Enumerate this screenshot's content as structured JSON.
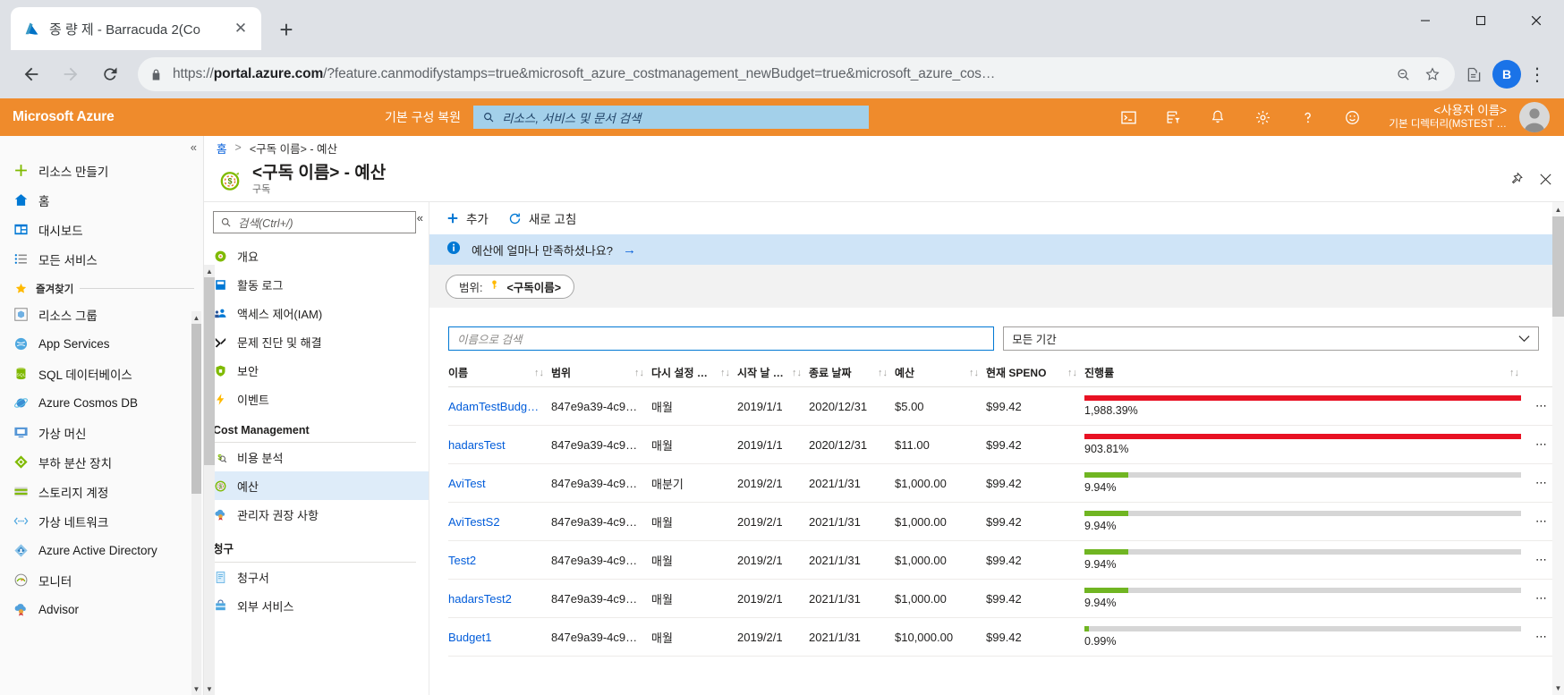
{
  "browser": {
    "tab_title": "종 량 제 - Barracuda 2(Co",
    "tab_close": "✕",
    "newtab": "+",
    "url_prefix": "https://",
    "url_domain": "portal.azure.com",
    "url_rest": "/?feature.canmodifystamps=true&microsoft_azure_costmanagement_newBudget=true&microsoft_azure_cos…",
    "profile_initial": "B",
    "ext_dots": "⋮"
  },
  "azure_header": {
    "brand": "Microsoft Azure",
    "restore_default": "기본 구성 복원",
    "search_placeholder": "리소스, 서비스 및 문서 검색",
    "user_name": "<사용자 이름>",
    "user_directory": "기본 디렉터리(MSTEST …",
    "icons": [
      "cloud-shell-icon",
      "directories-filter-icon",
      "notifications-icon",
      "settings-gear-icon",
      "help-icon",
      "feedback-smiley-icon"
    ]
  },
  "leftnav": {
    "collapse": "«",
    "items": [
      {
        "label": "리소스 만들기",
        "icon": "plus-icon"
      },
      {
        "label": "홈",
        "icon": "home-icon"
      },
      {
        "label": "대시보드",
        "icon": "dashboard-icon"
      },
      {
        "label": "모든 서비스",
        "icon": "all-services-icon"
      }
    ],
    "favorites_label": "즐겨찾기",
    "favorites": [
      {
        "label": "리소스 그룹",
        "icon": "resource-group-icon"
      },
      {
        "label": "App Services",
        "icon": "app-services-icon"
      },
      {
        "label": "SQL 데이터베이스",
        "icon": "sql-database-icon"
      },
      {
        "label": "Azure Cosmos DB",
        "icon": "cosmos-db-icon"
      },
      {
        "label": "가상 머신",
        "icon": "virtual-machine-icon"
      },
      {
        "label": "부하 분산 장치",
        "icon": "load-balancer-icon"
      },
      {
        "label": "스토리지 계정",
        "icon": "storage-account-icon"
      },
      {
        "label": "가상 네트워크",
        "icon": "virtual-network-icon"
      },
      {
        "label": "Azure Active Directory",
        "icon": "azure-ad-icon"
      },
      {
        "label": "모니터",
        "icon": "monitor-icon"
      },
      {
        "label": "Advisor",
        "icon": "advisor-icon"
      }
    ]
  },
  "blade": {
    "breadcrumb_home": "홈",
    "breadcrumb_sep": ">",
    "breadcrumb_current": "<구독 이름> - 예산",
    "title": "<구독 이름> - 예산",
    "subtitle": "구독",
    "pin_icon": "pin-icon",
    "close_icon": "close-icon",
    "menu_search_placeholder": "검색(Ctrl+/)",
    "menu_collapse": "«",
    "menu_items": [
      {
        "label": "개요",
        "icon": "overview-icon"
      },
      {
        "label": "활동 로그",
        "icon": "activity-log-icon"
      },
      {
        "label": "액세스 제어(IAM)",
        "icon": "access-control-icon"
      },
      {
        "label": "문제 진단 및 해결",
        "icon": "troubleshoot-icon"
      },
      {
        "label": "보안",
        "icon": "security-shield-icon"
      },
      {
        "label": "이벤트",
        "icon": "events-bolt-icon"
      }
    ],
    "group_cost_management": "Cost Management",
    "cost_items": [
      {
        "label": "비용 분석",
        "icon": "cost-analysis-icon",
        "active": false
      },
      {
        "label": "예산",
        "icon": "budget-icon",
        "active": true
      },
      {
        "label": "관리자 권장 사항",
        "icon": "advisor-recommendations-icon",
        "active": false
      }
    ],
    "group_billing": "청구",
    "billing_items": [
      {
        "label": "청구서",
        "icon": "invoice-icon"
      },
      {
        "label": "외부 서비스",
        "icon": "external-services-icon"
      }
    ]
  },
  "content": {
    "commands": [
      {
        "label": "추가",
        "icon": "plus-icon"
      },
      {
        "label": "새로 고침",
        "icon": "refresh-icon"
      }
    ],
    "info_message": "예산에 얼마나 만족하셨나요?",
    "info_arrow": "→",
    "info_icon": "info-icon",
    "scope_label": "범위:",
    "scope_icon": "key-icon",
    "scope_value": "<구독이름>",
    "search_placeholder": "이름으로 검색",
    "period_value": "모든 기간",
    "period_chevron": "⌄",
    "table": {
      "columns": [
        {
          "label": "이름",
          "sortable": true
        },
        {
          "label": "범위",
          "sortable": true
        },
        {
          "label": "다시 설정 …",
          "sortable": true
        },
        {
          "label": "시작 날 …",
          "sortable": true
        },
        {
          "label": "종료 날짜",
          "sortable": true
        },
        {
          "label": "예산",
          "sortable": true
        },
        {
          "label": "현재 SPENO",
          "sortable": true
        },
        {
          "label": "진행률",
          "sortable": true
        }
      ],
      "sort_glyph": "↑↓",
      "row_menu_glyph": "⋯",
      "rows": [
        {
          "name": "AdamTestBudg…",
          "scope": "847e9a39-4c9…",
          "reset": "매월",
          "start": "2019/1/1",
          "end": "2020/12/31",
          "budget": "$5.00",
          "spend": "$99.42",
          "progress_label": "1,988.39%",
          "progress_pct": 100,
          "progress_color": "#e81123"
        },
        {
          "name": "hadarsTest",
          "scope": "847e9a39-4c9…",
          "reset": "매월",
          "start": "2019/1/1",
          "end": "2020/12/31",
          "budget": "$11.00",
          "spend": "$99.42",
          "progress_label": "903.81%",
          "progress_pct": 100,
          "progress_color": "#e81123"
        },
        {
          "name": "AviTest",
          "scope": "847e9a39-4c9…",
          "reset": "매분기",
          "start": "2019/2/1",
          "end": "2021/1/31",
          "budget": "$1,000.00",
          "spend": "$99.42",
          "progress_label": "9.94%",
          "progress_pct": 9.94,
          "progress_color": "#70b522"
        },
        {
          "name": "AviTestS2",
          "scope": "847e9a39-4c9…",
          "reset": "매월",
          "start": "2019/2/1",
          "end": "2021/1/31",
          "budget": "$1,000.00",
          "spend": "$99.42",
          "progress_label": "9.94%",
          "progress_pct": 9.94,
          "progress_color": "#70b522"
        },
        {
          "name": "Test2",
          "scope": "847e9a39-4c9…",
          "reset": "매월",
          "start": "2019/2/1",
          "end": "2021/1/31",
          "budget": "$1,000.00",
          "spend": "$99.42",
          "progress_label": "9.94%",
          "progress_pct": 9.94,
          "progress_color": "#70b522"
        },
        {
          "name": "hadarsTest2",
          "scope": "847e9a39-4c9…",
          "reset": "매월",
          "start": "2019/2/1",
          "end": "2021/1/31",
          "budget": "$1,000.00",
          "spend": "$99.42",
          "progress_label": "9.94%",
          "progress_pct": 9.94,
          "progress_color": "#70b522"
        },
        {
          "name": "Budget1",
          "scope": "847e9a39-4c9…",
          "reset": "매월",
          "start": "2019/2/1",
          "end": "2021/1/31",
          "budget": "$10,000.00",
          "spend": "$99.42",
          "progress_label": "0.99%",
          "progress_pct": 0.99,
          "progress_color": "#70b522"
        }
      ]
    }
  },
  "colors": {
    "azure_orange": "#ef8b2c",
    "link_blue": "#015cda",
    "accent_blue": "#0078d4",
    "over_budget_red": "#e81123",
    "under_budget_green": "#70b522"
  }
}
